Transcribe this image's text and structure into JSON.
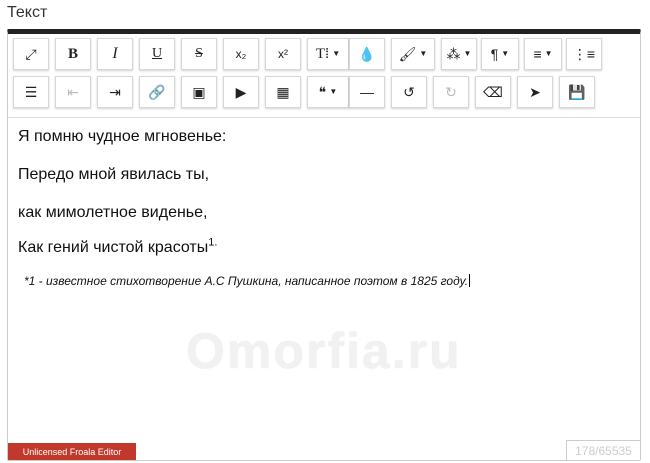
{
  "field": {
    "label": "Текст"
  },
  "toolbar": {
    "row1": [
      {
        "name": "fullscreen-button",
        "icon": "expand-icon",
        "glyph": "⤢",
        "caret": false,
        "disabled": false
      },
      {
        "name": "bold-button",
        "icon": "bold-icon",
        "glyph": "B",
        "caret": false,
        "disabled": false
      },
      {
        "name": "italic-button",
        "icon": "italic-icon",
        "glyph": "I",
        "caret": false,
        "disabled": false
      },
      {
        "name": "underline-button",
        "icon": "underline-icon",
        "glyph": "U",
        "caret": false,
        "disabled": false
      },
      {
        "name": "strikethrough-button",
        "icon": "strikethrough-icon",
        "glyph": "S",
        "caret": false,
        "disabled": false
      },
      {
        "name": "subscript-button",
        "icon": "subscript-icon",
        "glyph": "x₂",
        "caret": false,
        "disabled": false
      },
      {
        "name": "superscript-button",
        "icon": "superscript-icon",
        "glyph": "x²",
        "caret": false,
        "disabled": false
      },
      {
        "name": "font-size-button",
        "icon": "font-size-icon",
        "glyph": "T⁞",
        "caret": true,
        "disabled": false
      },
      {
        "name": "text-color-button",
        "icon": "droplet-icon",
        "glyph": "💧",
        "caret": false,
        "disabled": false
      },
      {
        "name": "paint-button",
        "icon": "paint-brush-icon",
        "glyph": "🖌",
        "caret": true,
        "disabled": false
      },
      {
        "name": "inline-style-button",
        "icon": "magic-wand-icon",
        "glyph": "⁂",
        "caret": true,
        "disabled": false
      },
      {
        "name": "paragraph-format-button",
        "icon": "pilcrow-icon",
        "glyph": "¶",
        "caret": true,
        "disabled": false
      },
      {
        "name": "align-button",
        "icon": "align-left-icon",
        "glyph": "≡",
        "caret": true,
        "disabled": false
      },
      {
        "name": "ordered-list-button",
        "icon": "ordered-list-icon",
        "glyph": "⋮≡",
        "caret": false,
        "disabled": false
      }
    ],
    "row2": [
      {
        "name": "unordered-list-button",
        "icon": "unordered-list-icon",
        "glyph": "☰",
        "caret": false,
        "disabled": false
      },
      {
        "name": "outdent-button",
        "icon": "outdent-icon",
        "glyph": "⇤",
        "caret": false,
        "disabled": true
      },
      {
        "name": "indent-button",
        "icon": "indent-icon",
        "glyph": "⇥",
        "caret": false,
        "disabled": false
      },
      {
        "name": "insert-link-button",
        "icon": "link-icon",
        "glyph": "🔗",
        "caret": false,
        "disabled": false
      },
      {
        "name": "insert-image-button",
        "icon": "image-icon",
        "glyph": "▣",
        "caret": false,
        "disabled": false
      },
      {
        "name": "insert-video-button",
        "icon": "video-camera-icon",
        "glyph": "▶",
        "caret": false,
        "disabled": false
      },
      {
        "name": "insert-table-button",
        "icon": "table-icon",
        "glyph": "▦",
        "caret": false,
        "disabled": false
      },
      {
        "name": "quote-button",
        "icon": "quote-icon",
        "glyph": "❝",
        "caret": true,
        "disabled": false
      },
      {
        "name": "horizontal-line-button",
        "icon": "minus-icon",
        "glyph": "—",
        "caret": false,
        "disabled": false
      },
      {
        "name": "undo-button",
        "icon": "undo-icon",
        "glyph": "↺",
        "caret": false,
        "disabled": false
      },
      {
        "name": "redo-button",
        "icon": "redo-icon",
        "glyph": "↻",
        "caret": false,
        "disabled": true
      },
      {
        "name": "clear-formatting-button",
        "icon": "eraser-icon",
        "glyph": "⌫",
        "caret": false,
        "disabled": false
      },
      {
        "name": "select-all-button",
        "icon": "cursor-arrow-icon",
        "glyph": "➤",
        "caret": false,
        "disabled": false
      },
      {
        "name": "save-button",
        "icon": "floppy-disk-icon",
        "glyph": "💾",
        "caret": false,
        "disabled": false
      }
    ]
  },
  "content": {
    "lines": [
      "Я помню чудное мгновенье:",
      "Передо мной явилась ты,",
      "как мимолетное виденье,",
      "Как гений чистой красоты"
    ],
    "footnote_marker": "1.",
    "note": "*1 - известное стихотворение А.С Пушкина, написанное поэтом в 1825 году."
  },
  "watermark": "Omorfia.ru",
  "footer": {
    "license_badge": "Unlicensed Froala Editor",
    "char_counter": "178/65535"
  },
  "colors": {
    "toolbar_top_border": "#222222",
    "license_badge_bg": "#c0392b",
    "disabled_icon": "#bbbbbb"
  }
}
